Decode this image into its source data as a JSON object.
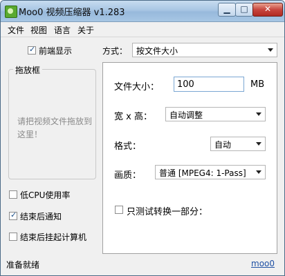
{
  "window": {
    "title": "Moo0 视频压缩器 v1.283"
  },
  "menu": [
    "文件",
    "视图",
    "语言",
    "关于"
  ],
  "left": {
    "always_on_top": {
      "label": "前端显示",
      "checked": true
    },
    "drop_box": {
      "title": "拖放框",
      "hint": "请把视频文件拖放到这里！"
    },
    "low_cpu": {
      "label": "低CPU使用率",
      "checked": false
    },
    "notify_end": {
      "label": "结束后通知",
      "checked": true
    },
    "hibernate_end": {
      "label": "结束后挂起计算机",
      "checked": false
    }
  },
  "mode": {
    "label": "方式：",
    "value": "按文件大小"
  },
  "settings": {
    "file_size": {
      "label": "文件大小：",
      "value": "100",
      "unit": "MB"
    },
    "dimensions": {
      "label": "宽 x 高：",
      "value": "自动调整"
    },
    "format": {
      "label": "格式：",
      "value": "自动"
    },
    "quality": {
      "label": "画质：",
      "value": "普通  [MPEG4: 1-Pass]"
    },
    "test_part": {
      "label": "只测试转换一部分：",
      "checked": false
    }
  },
  "status": {
    "text": "准备就绪",
    "link": "moo0"
  }
}
